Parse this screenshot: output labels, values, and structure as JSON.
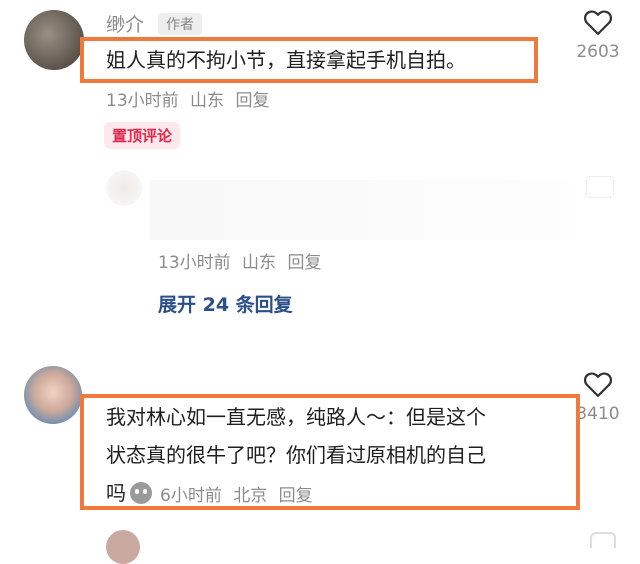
{
  "comments": [
    {
      "username": "缈介",
      "author_badge": "作者",
      "text": "姐人真的不拘小节，直接拿起手机自拍。",
      "time": "13小时前",
      "location": "山东",
      "reply_label": "回复",
      "likes": "2603",
      "pinned_label": "置顶评论",
      "sub_reply": {
        "time": "13小时前",
        "location": "山东",
        "reply_label": "回复"
      },
      "expand_label": "展开 24 条回复"
    },
    {
      "text_line1": "我对林心如一直无感，纯路人～：但是这个",
      "text_line2": "状态真的很牛了吧？你们看过原相机的自己",
      "text_line3": "吗",
      "time": "6小时前",
      "location": "北京",
      "reply_label": "回复",
      "likes": "3410"
    }
  ],
  "icons": {
    "like": "heart-outline-icon",
    "emoji": "ghost-emoji-icon"
  },
  "colors": {
    "highlight": "#f07a3c",
    "pinned_text": "#e3264a",
    "link": "#2b4f8a",
    "meta": "#8c8c8c"
  }
}
